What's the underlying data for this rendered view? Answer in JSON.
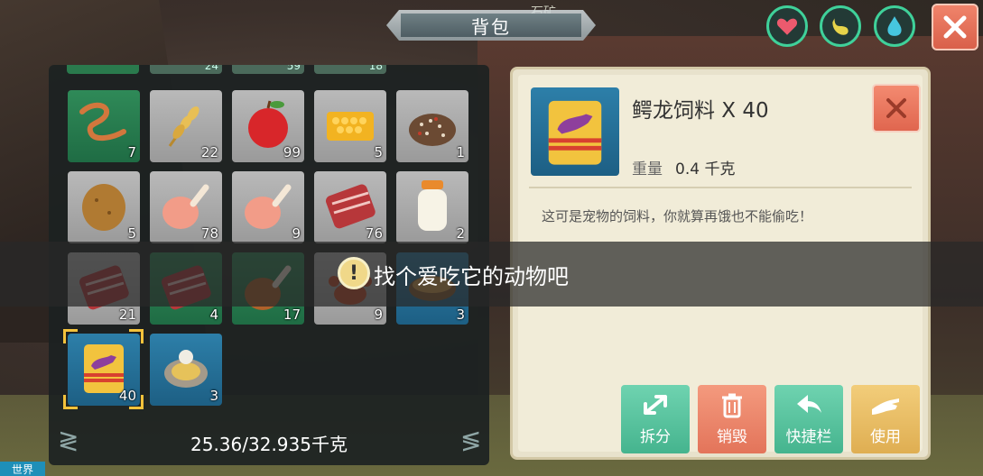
{
  "hud": {
    "title": "背包",
    "ore_label": "石矿",
    "world_tag": "世界",
    "status_icons": [
      "heart-icon",
      "stomach-icon",
      "water-drop-icon"
    ]
  },
  "inventory": {
    "top_counts": [
      "24",
      "59",
      "18"
    ],
    "slots": [
      {
        "icon": "worm-icon",
        "count": "7",
        "bg": "green"
      },
      {
        "icon": "wheat-icon",
        "count": "22",
        "bg": "gray"
      },
      {
        "icon": "apple-icon",
        "count": "99",
        "bg": "gray"
      },
      {
        "icon": "honeycomb-icon",
        "count": "5",
        "bg": "gray"
      },
      {
        "icon": "seeds-icon",
        "count": "1",
        "bg": "gray"
      },
      {
        "icon": "potato-icon",
        "count": "5",
        "bg": "gray"
      },
      {
        "icon": "raw-drumstick-icon",
        "count": "78",
        "bg": "gray"
      },
      {
        "icon": "raw-drumstick-icon",
        "count": "9",
        "bg": "gray"
      },
      {
        "icon": "raw-meat-icon",
        "count": "76",
        "bg": "gray"
      },
      {
        "icon": "milk-bottle-icon",
        "count": "2",
        "bg": "gray"
      },
      {
        "icon": "raw-meat-icon",
        "count": "21",
        "bg": "gray"
      },
      {
        "icon": "raw-meat-icon",
        "count": "4",
        "bg": "green"
      },
      {
        "icon": "cooked-drumstick-icon",
        "count": "17",
        "bg": "green"
      },
      {
        "icon": "crab-icon",
        "count": "9",
        "bg": "gray"
      },
      {
        "icon": "stew-bowl-icon",
        "count": "3",
        "bg": "blue"
      },
      {
        "icon": "pet-food-bag-icon",
        "count": "40",
        "bg": "blue"
      },
      {
        "icon": "oyster-icon",
        "count": "3",
        "bg": "blue"
      }
    ],
    "weight": "25.36/32.935千克"
  },
  "detail": {
    "name": "鳄龙饲料 X 40",
    "weight_label": "重量",
    "weight_value": "0.4 千克",
    "description": "这可是宠物的饲料，你就算再饿也不能偷吃！",
    "actions": {
      "split": "拆分",
      "destroy": "销毁",
      "shortcut": "快捷栏",
      "use": "使用"
    }
  },
  "toast": {
    "text": "找个爱吃它的动物吧"
  },
  "colors": {
    "accent_green": "#3fd19a",
    "selected_gold": "#f3c23b",
    "close_red": "#e0664f"
  }
}
